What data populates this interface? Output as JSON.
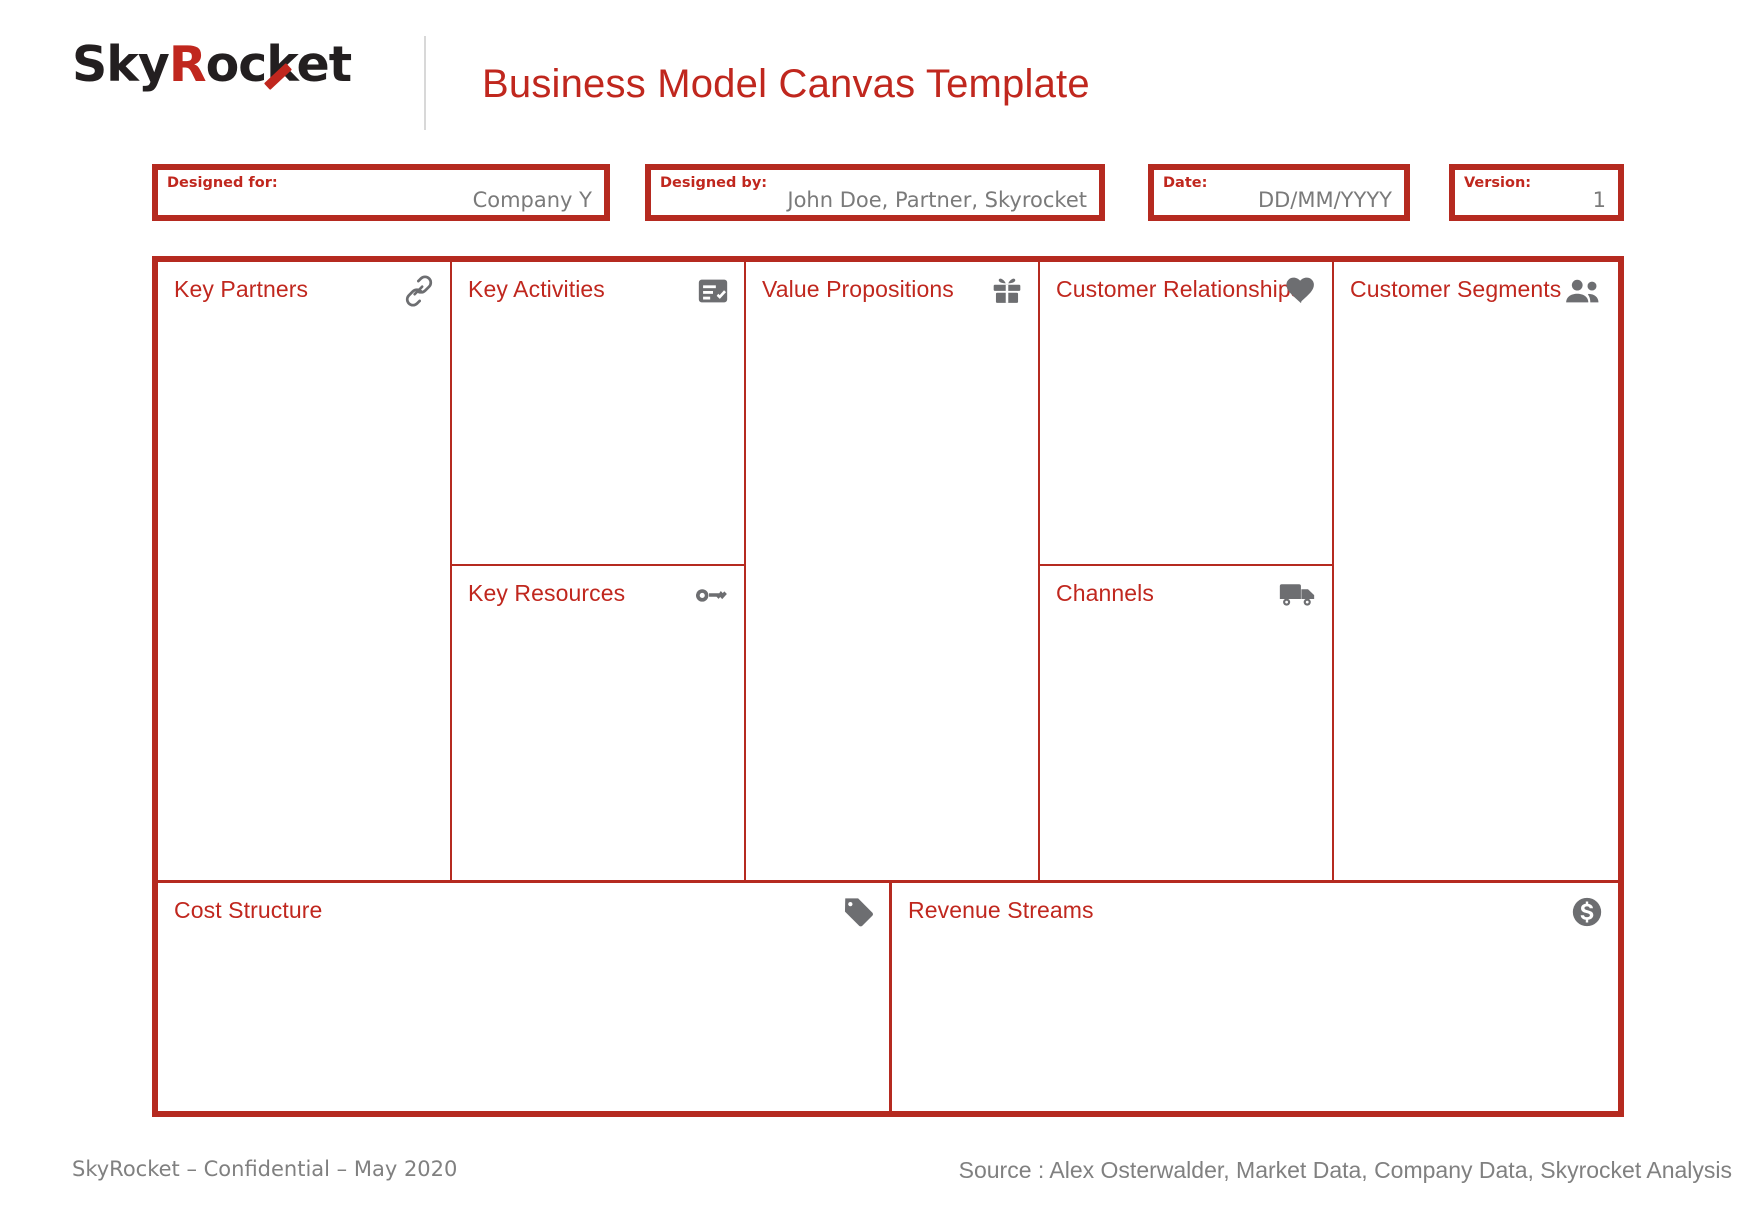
{
  "brand": {
    "logo_part1": "Sky",
    "logo_part2": "R",
    "logo_part3": "ocket",
    "accent_color": "#c0271e",
    "border_color": "#b52a20",
    "icon_color": "#6d6e71"
  },
  "header": {
    "title": "Business Model Canvas Template"
  },
  "meta": {
    "designed_for": {
      "label": "Designed for:",
      "value": "Company Y"
    },
    "designed_by": {
      "label": "Designed by:",
      "value": "John Doe, Partner, Skyrocket"
    },
    "date": {
      "label": "Date:",
      "value": "DD/MM/YYYY"
    },
    "version": {
      "label": "Version:",
      "value": "1"
    }
  },
  "canvas": {
    "key_partners": {
      "title": "Key Partners",
      "icon": "link-icon",
      "content": ""
    },
    "key_activities": {
      "title": "Key Activities",
      "icon": "checklist-icon",
      "content": ""
    },
    "key_resources": {
      "title": "Key Resources",
      "icon": "key-icon",
      "content": ""
    },
    "value_propositions": {
      "title": "Value Propositions",
      "icon": "gift-icon",
      "content": ""
    },
    "customer_relationships": {
      "title": "Customer Relationships",
      "icon": "heart-icon",
      "content": ""
    },
    "channels": {
      "title": "Channels",
      "icon": "truck-icon",
      "content": ""
    },
    "customer_segments": {
      "title": "Customer Segments",
      "icon": "people-icon",
      "content": ""
    },
    "cost_structure": {
      "title": "Cost Structure",
      "icon": "tag-icon",
      "content": ""
    },
    "revenue_streams": {
      "title": "Revenue Streams",
      "icon": "dollar-coin-icon",
      "content": ""
    }
  },
  "footer": {
    "left": "SkyRocket – Confidential – May 2020",
    "right": "Source : Alex Osterwalder, Market Data, Company Data, Skyrocket Analysis"
  }
}
